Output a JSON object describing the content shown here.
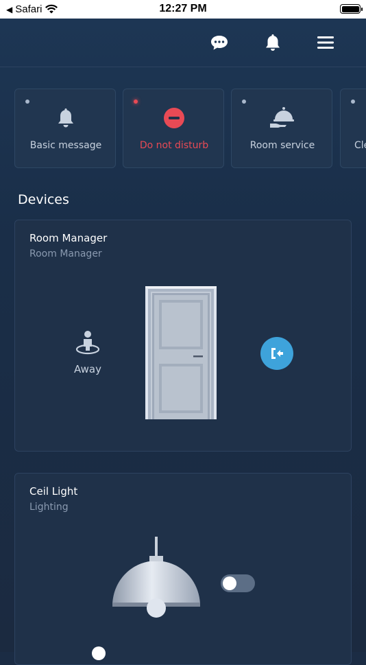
{
  "status_bar": {
    "back_app": "Safari",
    "time": "12:27 PM"
  },
  "topbar": {
    "icons": [
      "chat-icon",
      "bell-icon",
      "menu-icon"
    ]
  },
  "scenes": [
    {
      "label": "Basic message",
      "icon": "bell-icon",
      "active": false
    },
    {
      "label": "Do not disturb",
      "icon": "do-not-disturb-icon",
      "active": true
    },
    {
      "label": "Room service",
      "icon": "room-service-icon",
      "active": false
    },
    {
      "label": "Cle",
      "icon": "unknown",
      "active": false
    }
  ],
  "devices": {
    "title": "Devices",
    "room_manager": {
      "name": "Room Manager",
      "type": "Room Manager",
      "presence": "Away"
    },
    "ceil_light": {
      "name": "Ceil Light",
      "type": "Lighting",
      "on": false
    }
  },
  "colors": {
    "accent_blue": "#3ea3db",
    "alert_red": "#e84a55",
    "background": "#1b2c44"
  }
}
